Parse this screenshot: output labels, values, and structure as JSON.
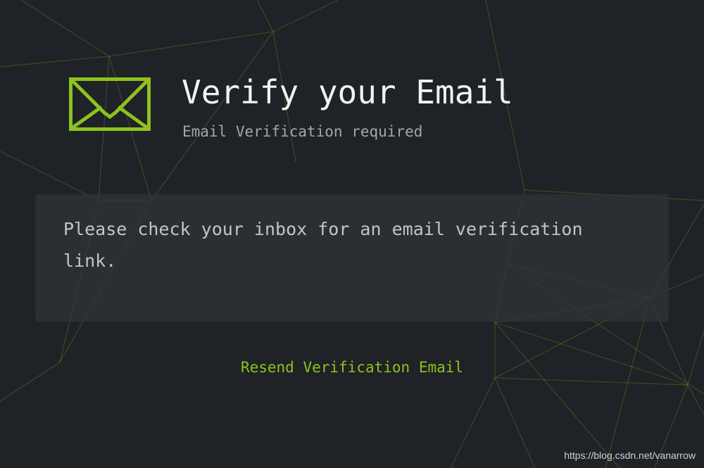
{
  "header": {
    "title": "Verify your Email",
    "subtitle": "Email Verification required"
  },
  "message": {
    "text": "Please check your inbox for an email verification link."
  },
  "actions": {
    "resend_label": "Resend Verification Email"
  },
  "watermark": "https://blog.csdn.net/vanarrow",
  "icons": {
    "envelope": "envelope-icon"
  },
  "colors": {
    "background": "#1f2226",
    "accent": "#8dc21f",
    "title": "#f2f2f2",
    "muted": "#a3a7ac",
    "panel": "#2e3338"
  }
}
